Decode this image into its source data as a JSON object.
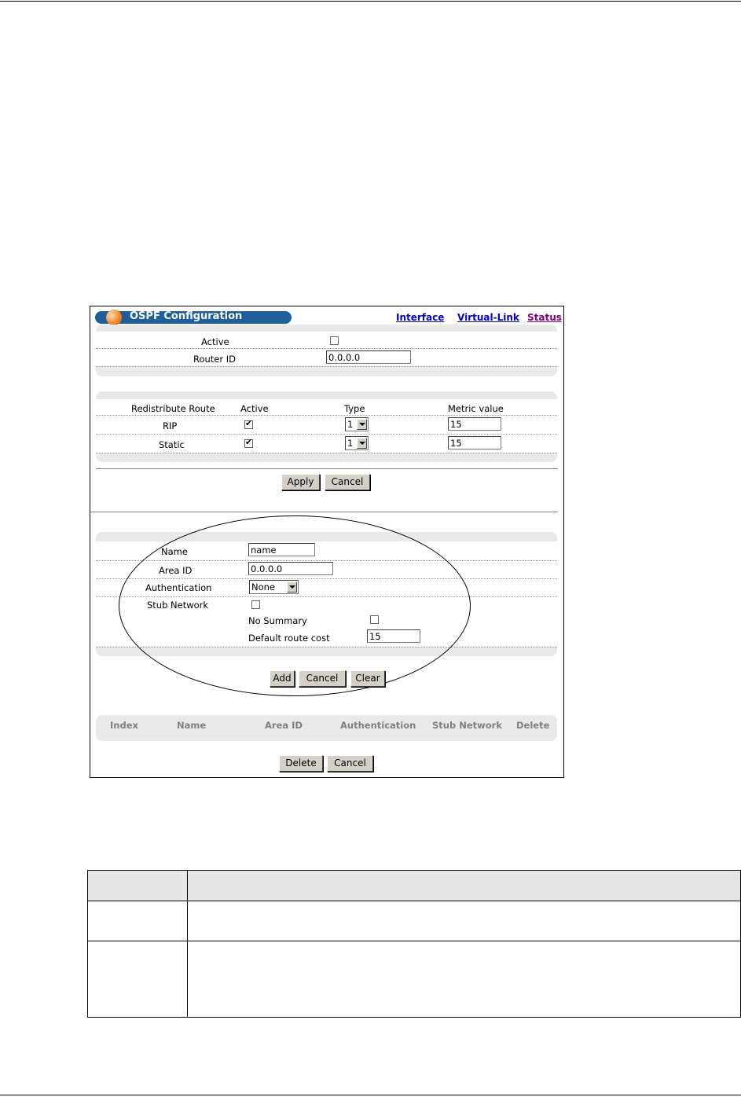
{
  "header": {
    "title": "OSPF Configuration"
  },
  "nav_links": [
    {
      "label": "Interface",
      "color": "#0000cc"
    },
    {
      "label": "Virtual-Link",
      "color": "#0000cc"
    },
    {
      "label": "Status",
      "color": "#800080"
    }
  ],
  "general": {
    "active_label": "Active",
    "active_checked": false,
    "router_id_label": "Router ID",
    "router_id_value": "0.0.0.0"
  },
  "redistribute": {
    "headers": [
      "Redistribute Route",
      "Active",
      "Type",
      "Metric value"
    ],
    "rows": [
      {
        "name": "RIP",
        "active": true,
        "type": "1",
        "metric": "15"
      },
      {
        "name": "Static",
        "active": true,
        "type": "1",
        "metric": "15"
      }
    ]
  },
  "buttons_top": {
    "apply": "Apply",
    "cancel": "Cancel"
  },
  "area": {
    "name_label": "Name",
    "name_value": "name",
    "area_id_label": "Area ID",
    "area_id_value": "0.0.0.0",
    "auth_label": "Authentication",
    "auth_value": "None",
    "stub_label": "Stub Network",
    "stub_checked": false,
    "no_summary_label": "No Summary",
    "no_summary_checked": false,
    "default_cost_label": "Default route cost",
    "default_cost_value": "15"
  },
  "buttons_area": {
    "add": "Add",
    "cancel": "Cancel",
    "clear": "Clear"
  },
  "summary_table": {
    "headers": [
      "Index",
      "Name",
      "Area ID",
      "Authentication",
      "Stub Network",
      "Delete"
    ]
  },
  "buttons_bottom": {
    "delete": "Delete",
    "cancel": "Cancel"
  },
  "colors": {
    "title_bar": "#1f5e9a",
    "panel": "#e9e9e9",
    "button": "#d4d0c8",
    "table_header": "#e6e6e6"
  }
}
